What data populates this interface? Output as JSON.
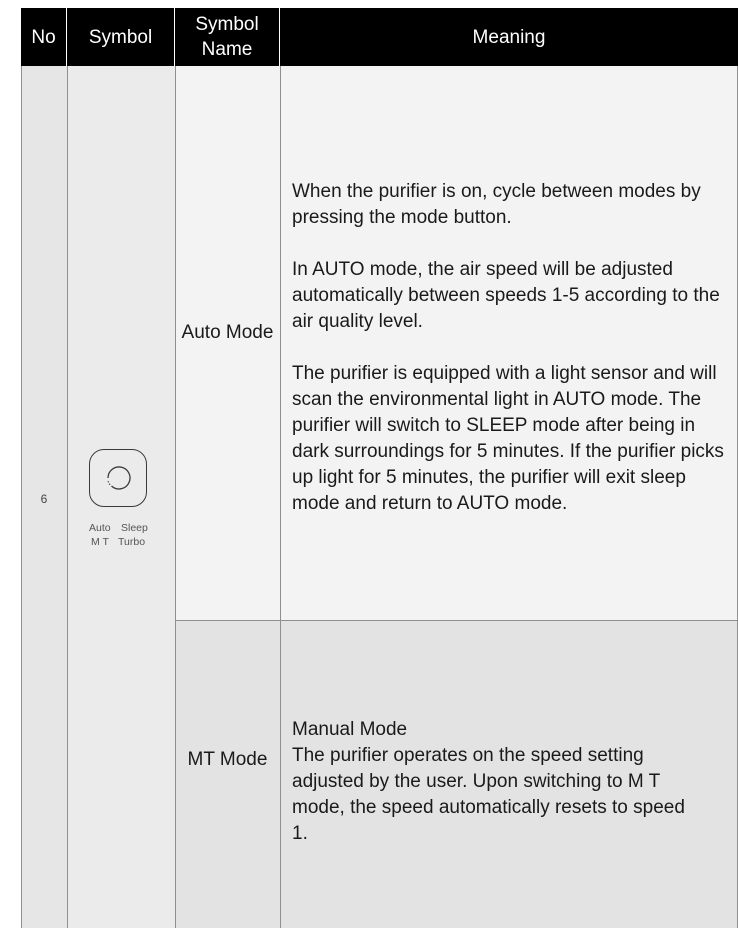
{
  "header": {
    "no": "No",
    "symbol": "Symbol",
    "symbol_name": "Symbol Name",
    "meaning": "Meaning"
  },
  "row": {
    "no": "6",
    "symbol_icon": "circular-arrow-icon",
    "symbol_labels": {
      "auto": "Auto",
      "sleep": "Sleep",
      "mt": "M T",
      "turbo": "Turbo"
    }
  },
  "modes": [
    {
      "name": "Auto Mode",
      "paragraphs": [
        "When the purifier is on, cycle between modes by pressing the mode button.",
        "In AUTO mode, the air speed will be adjusted automatically between speeds 1-5 according to the air quality level.",
        "The purifier is equipped with a light sensor and will scan the environmental light in AUTO mode. The purifier will switch to SLEEP mode after being in dark surroundings for 5 minutes. If the purifier picks up light for 5 minutes, the purifier will exit sleep mode and return to AUTO mode."
      ]
    },
    {
      "name": "MT Mode",
      "title": "Manual Mode",
      "description": "The purifier operates on the speed setting adjusted by the user. Upon switching to M T mode, the speed automatically resets to speed 1."
    }
  ],
  "colors": {
    "header_bg": "#000000",
    "header_text": "#ffffff",
    "row_bg_light": "#f3f3f3",
    "row_bg_dark": "#e3e3e3",
    "grid_line": "#8f8f8f"
  }
}
